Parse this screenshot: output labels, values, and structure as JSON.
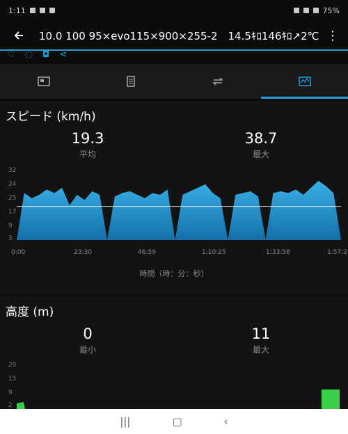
{
  "status": {
    "time": "1:11",
    "battery": "75%"
  },
  "appbar": {
    "title": "10.0 100 95×evo115×900×255-2　14.5ｷﾛ146ｷﾛ↗2℃",
    "more": "⋮"
  },
  "tabs": [
    "summary-icon",
    "details-icon",
    "laps-icon",
    "charts-icon"
  ],
  "speed": {
    "title": "スピード (km/h)",
    "avg_value": "19.3",
    "avg_label": "平均",
    "max_value": "38.7",
    "max_label": "最大",
    "x_title": "時間（時：分：秒）",
    "x_ticks": [
      "0:00",
      "23:30",
      "46:59",
      "1:10:25",
      "1:33:58",
      "1:57:28"
    ],
    "y_ticks": [
      "32",
      "24",
      "25",
      "17",
      "9",
      "3"
    ]
  },
  "altitude": {
    "title": "高度 (m)",
    "min_value": "0",
    "min_label": "最小",
    "max_value": "11",
    "max_label": "最大",
    "y_ticks": [
      "20",
      "15",
      "9",
      "2"
    ]
  },
  "chart_data": [
    {
      "type": "area",
      "title": "スピード (km/h)",
      "xlabel": "時間（時：分：秒）",
      "ylabel": "",
      "x": [
        "0:00",
        "23:30",
        "46:59",
        "1:10:25",
        "1:33:58",
        "1:57:28"
      ],
      "series": [
        {
          "values": [
            0,
            27,
            24,
            26,
            29,
            27,
            30,
            20,
            26,
            23,
            28,
            26,
            0,
            25,
            27,
            28,
            26,
            24,
            27,
            26,
            29,
            0,
            26,
            28,
            30,
            32,
            27,
            24,
            0,
            26,
            27,
            28,
            25,
            0,
            27,
            28,
            27,
            29,
            26,
            30,
            34,
            31,
            27,
            0
          ]
        }
      ],
      "avg_line": 19.3,
      "ylim": [
        0,
        40
      ]
    },
    {
      "type": "area",
      "title": "高度 (m)",
      "ylim": [
        0,
        20
      ]
    }
  ]
}
